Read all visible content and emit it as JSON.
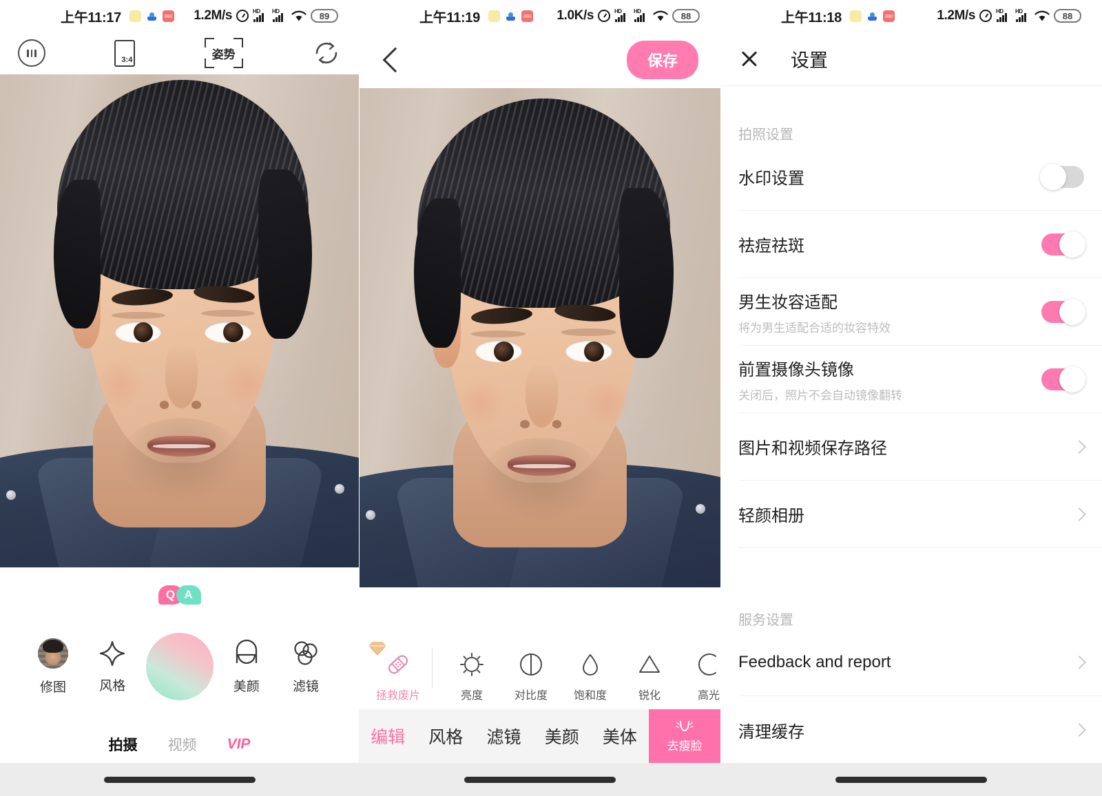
{
  "panels": [
    {
      "id": "camera",
      "status_bar": {
        "time": "上午11:17",
        "speed": "1.2M/s",
        "battery": "89",
        "hd_label_1": "HD",
        "hd_label_2": "HD"
      },
      "top_bar": {
        "menu_icon": "more-dots-icon",
        "ratio_label": "3:4",
        "pose_label": "姿势",
        "flip_icon": "camera-flip-icon"
      },
      "qa_badge": {
        "q": "Q",
        "a": "A"
      },
      "tools": [
        {
          "label": "修图",
          "icon": "photo-thumbnail-icon"
        },
        {
          "label": "风格",
          "icon": "sparkle-icon"
        },
        {
          "label": "",
          "icon": "shutter-button"
        },
        {
          "label": "美颜",
          "icon": "beauty-face-icon"
        },
        {
          "label": "滤镜",
          "icon": "filter-circles-icon"
        }
      ],
      "tabs": [
        {
          "label": "拍摄",
          "state": "active"
        },
        {
          "label": "视频",
          "state": "inactive"
        },
        {
          "label": "VIP",
          "state": "vip"
        }
      ]
    },
    {
      "id": "editor",
      "status_bar": {
        "time": "上午11:19",
        "speed": "1.0K/s",
        "battery": "88",
        "hd_label_1": "HD",
        "hd_label_2": "HD"
      },
      "top_bar": {
        "back_icon": "back-chevron-icon",
        "save_label": "保存"
      },
      "adjust_tools": [
        {
          "label": "拯救废片",
          "icon": "bandage-icon",
          "vip": true
        },
        {
          "label": "亮度",
          "icon": "brightness-sun-icon",
          "vip": false
        },
        {
          "label": "对比度",
          "icon": "contrast-circle-icon",
          "vip": false
        },
        {
          "label": "饱和度",
          "icon": "saturation-drop-icon",
          "vip": false
        },
        {
          "label": "锐化",
          "icon": "sharpen-triangle-icon",
          "vip": false
        },
        {
          "label": "高光",
          "icon": "highlight-arc-icon",
          "vip": false
        }
      ],
      "tabs": [
        {
          "label": "编辑",
          "state": "active"
        },
        {
          "label": "风格",
          "state": "inactive"
        },
        {
          "label": "滤镜",
          "state": "inactive"
        },
        {
          "label": "美颜",
          "state": "inactive"
        },
        {
          "label": "美体",
          "state": "inactive"
        }
      ],
      "slim_button": {
        "label": "去瘦脸",
        "icon": "slim-face-icon"
      }
    },
    {
      "id": "settings",
      "status_bar": {
        "time": "上午11:18",
        "speed": "1.2M/s",
        "battery": "88",
        "hd_label_1": "HD",
        "hd_label_2": "HD"
      },
      "top_bar": {
        "close_icon": "close-x-icon",
        "title": "设置"
      },
      "groups": [
        {
          "label": "拍照设置",
          "rows": [
            {
              "title": "水印设置",
              "sub": "",
              "control": "toggle",
              "value": "off"
            },
            {
              "title": "祛痘祛斑",
              "sub": "",
              "control": "toggle",
              "value": "on"
            },
            {
              "title": "男生妆容适配",
              "sub": "将为男生适配合适的妆容特效",
              "control": "toggle",
              "value": "on"
            },
            {
              "title": "前置摄像头镜像",
              "sub": "关闭后，照片不会自动镜像翻转",
              "control": "toggle",
              "value": "on"
            },
            {
              "title": "图片和视频保存路径",
              "sub": "",
              "control": "chevron",
              "value": ""
            },
            {
              "title": "轻颜相册",
              "sub": "",
              "control": "chevron",
              "value": ""
            }
          ]
        },
        {
          "label": "服务设置",
          "rows": [
            {
              "title": "Feedback and report",
              "sub": "",
              "control": "chevron",
              "value": ""
            },
            {
              "title": "清理缓存",
              "sub": "",
              "control": "chevron",
              "value": ""
            }
          ]
        }
      ]
    }
  ],
  "colors": {
    "accent_pink": "#ff7bb0",
    "vip_pink": "#ff5f96",
    "toggle_on": "#ff7ab0",
    "toggle_off": "#d8d8d8",
    "mint": "#8fe6c6"
  }
}
